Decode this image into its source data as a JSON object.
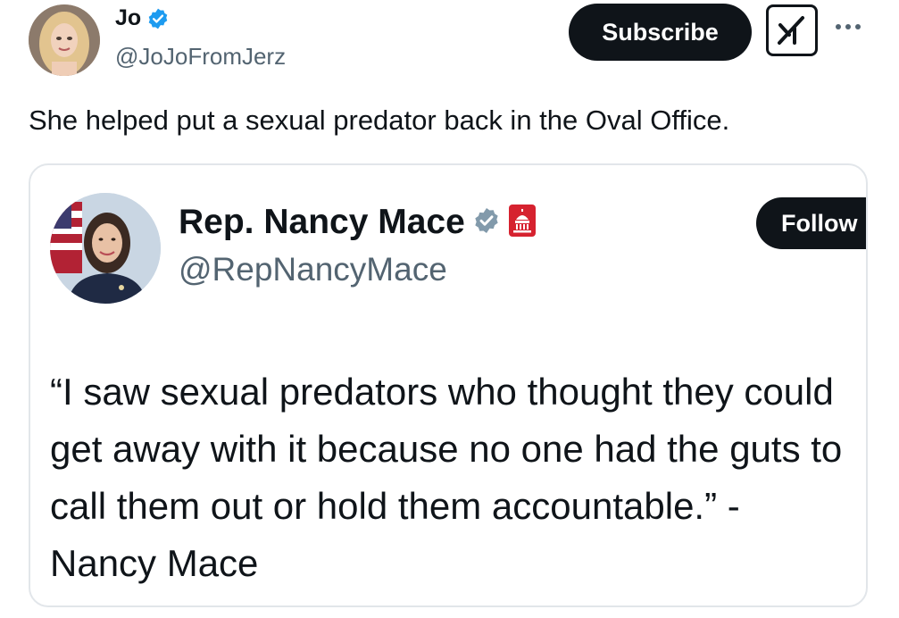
{
  "author": {
    "display_name": "Jo",
    "handle": "@JoJoFromJerz",
    "verified_icon": "verified-badge-blue"
  },
  "header_actions": {
    "subscribe_label": "Subscribe",
    "grok_icon": "grok-icon",
    "more_icon": "more-horizontal-icon"
  },
  "tweet": {
    "text": "She helped put a sexual predator back in the Oval Office."
  },
  "quoted_tweet": {
    "display_name": "Rep. Nancy Mace",
    "handle": "@RepNancyMace",
    "verified_icon": "verified-badge-gray",
    "affiliation_icon": "us-capitol-badge",
    "follow_label": "Follow",
    "text": "“I saw sexual predators who thought they could get away with it because no one had the guts to call them out or hold them accountable.” - Nancy Mace"
  },
  "colors": {
    "text_primary": "#0f1419",
    "text_secondary": "#536471",
    "verified_blue": "#1d9bf0",
    "verified_gray": "#829aab",
    "capitol_red": "#d6222f",
    "button_dark": "#0f1419",
    "card_border": "#e2e6ea"
  }
}
